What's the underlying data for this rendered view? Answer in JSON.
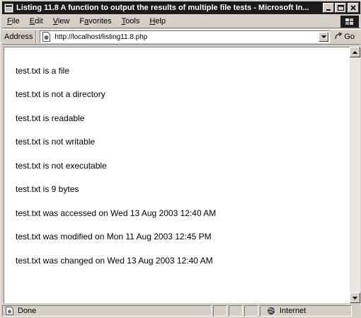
{
  "window": {
    "title": "Listing 11.8 A function to output the results of multiple file tests - Microsoft In..."
  },
  "menu": {
    "items": [
      {
        "key": "F",
        "rest": "ile"
      },
      {
        "key": "E",
        "rest": "dit"
      },
      {
        "key": "V",
        "rest": "iew"
      },
      {
        "key": "a",
        "pre": "F",
        "rest": "vorites"
      },
      {
        "key": "T",
        "rest": "ools"
      },
      {
        "key": "H",
        "rest": "elp"
      }
    ]
  },
  "address": {
    "label": "Address",
    "value": "http://localhost/listing11.8.php",
    "go_label": "Go"
  },
  "content": {
    "lines": [
      "test.txt is a file",
      "test.txt is not a directory",
      "test.txt is readable",
      "test.txt is not writable",
      "test.txt is not executable",
      "test.txt is 9 bytes",
      "test.txt was accessed on Wed 13 Aug 2003 12:40 AM",
      "test.txt was modified on Mon 11 Aug 2003 12:45 PM",
      "test.txt was changed on Wed 13 Aug 2003 12:40 AM"
    ]
  },
  "status": {
    "text": "Done",
    "zone": "Internet"
  }
}
